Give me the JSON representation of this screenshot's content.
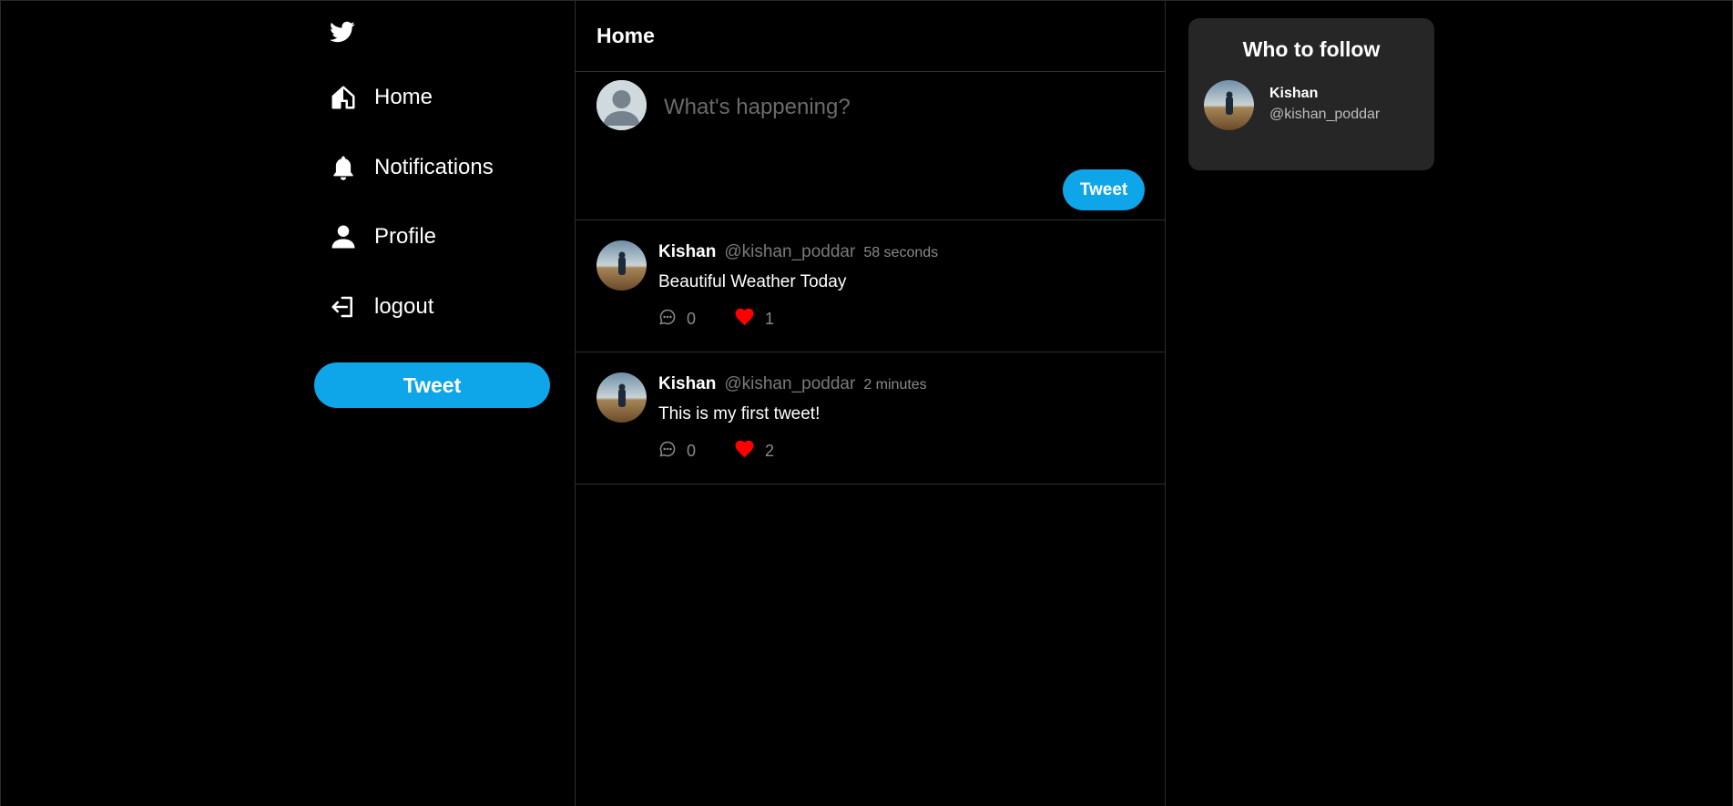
{
  "sidebar": {
    "logo_icon": "twitter-bird-icon",
    "items": [
      {
        "label": "Home",
        "icon": "home-icon"
      },
      {
        "label": "Notifications",
        "icon": "bell-icon"
      },
      {
        "label": "Profile",
        "icon": "user-icon"
      },
      {
        "label": "logout",
        "icon": "logout-icon"
      }
    ],
    "tweet_button_label": "Tweet"
  },
  "main": {
    "header_title": "Home",
    "composer": {
      "placeholder": "What's happening?",
      "tweet_button_label": "Tweet"
    },
    "tweets": [
      {
        "name": "Kishan",
        "handle": "@kishan_poddar",
        "time": "58 seconds",
        "text": "Beautiful Weather Today",
        "comments": "0",
        "likes": "1"
      },
      {
        "name": "Kishan",
        "handle": "@kishan_poddar",
        "time": "2 minutes",
        "text": "This is my first tweet!",
        "comments": "0",
        "likes": "2"
      }
    ]
  },
  "right_panel": {
    "who_to_follow": {
      "title": "Who to follow",
      "users": [
        {
          "name": "Kishan",
          "handle": "@kishan_poddar"
        }
      ]
    }
  },
  "colors": {
    "accent": "#0ea5e9",
    "like": "#ff0000",
    "background": "#000000",
    "card": "#262626"
  }
}
